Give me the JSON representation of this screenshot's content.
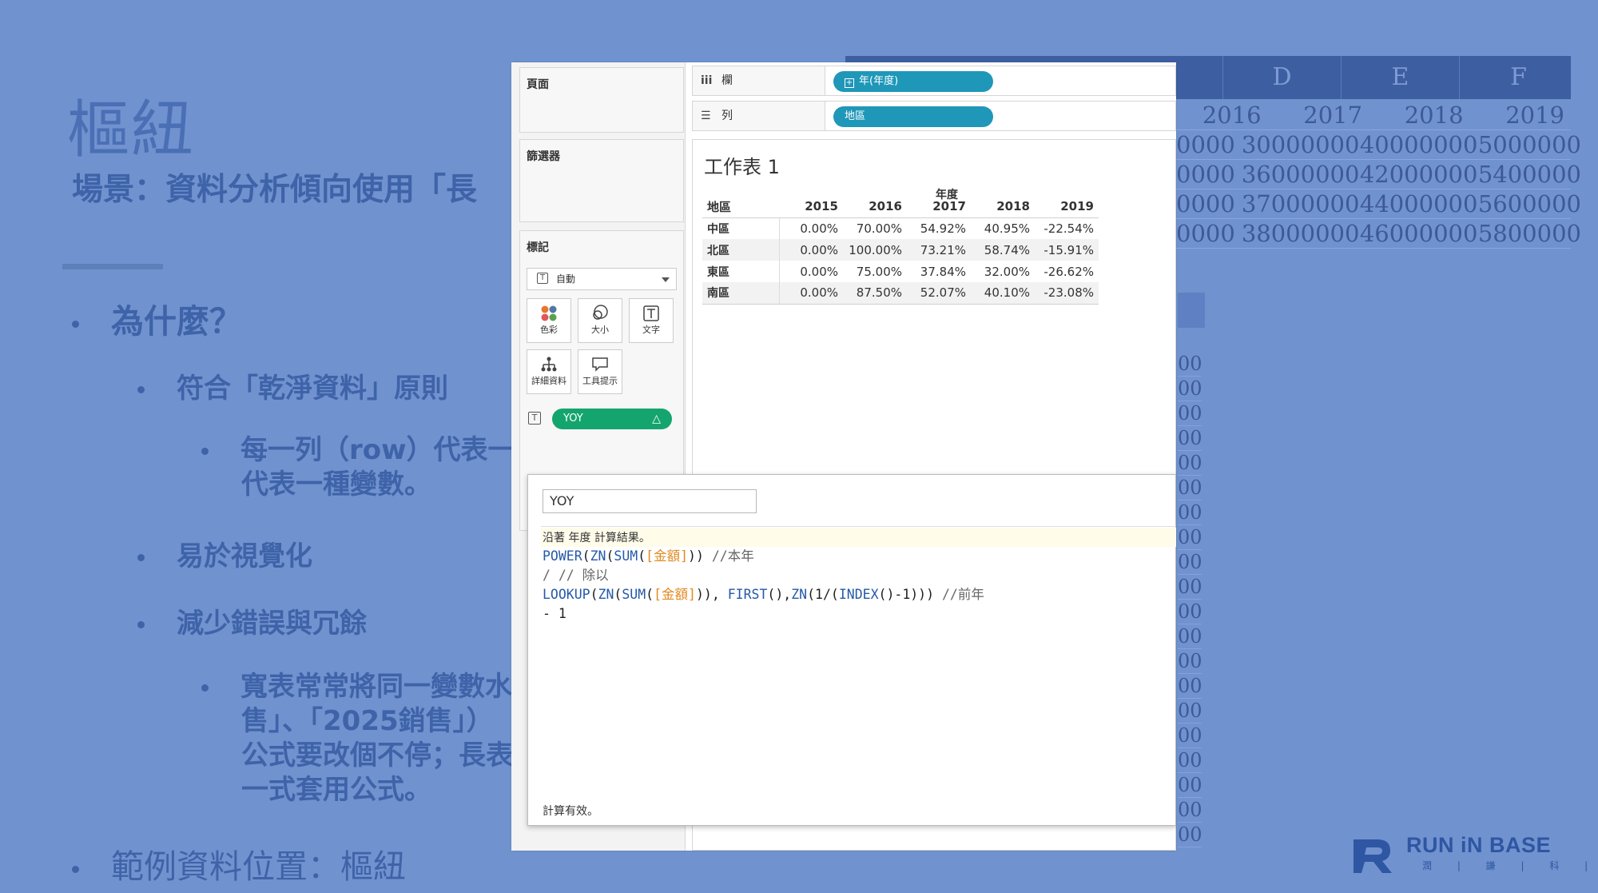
{
  "slide": {
    "title": "樞紐",
    "subtitle": "場景：資料分析傾向使用「長",
    "bullets": {
      "b1": "為什麼？",
      "b2": "符合「乾淨資料」原則",
      "b3_line1": "每一列（row）代表一",
      "b3_line2": "代表一種變數。",
      "b4": "易於視覺化",
      "b5": "減少錯誤與冗餘",
      "b6_line1": "寬表常常將同一變數水",
      "b6_line2": "售」、「2025銷售」）",
      "b6_line3": "公式要改個不停；長表",
      "b6_line4": "一式套用公式。",
      "b7": "範例資料位置：樞紐"
    }
  },
  "background_sheet": {
    "columns": [
      "D",
      "E",
      "F"
    ],
    "rows": [
      [
        "2016",
        "2017",
        "2018",
        "2019"
      ],
      [
        "0000",
        "30000000",
        "40000000",
        "5000000"
      ],
      [
        "0000",
        "36000000",
        "42000000",
        "5400000"
      ],
      [
        "0000",
        "37000000",
        "44000000",
        "5600000"
      ],
      [
        "0000",
        "38000000",
        "46000000",
        "5800000"
      ]
    ],
    "side_values": [
      "00",
      "00",
      "00",
      "00",
      "00",
      "00",
      "00",
      "00",
      "00",
      "00",
      "00",
      "00",
      "00",
      "00",
      "00",
      "00",
      "00",
      "00",
      "00",
      "00"
    ]
  },
  "logo": {
    "text": "RUN iN BASE",
    "sub": "潤 | 謙 | 科 | 技"
  },
  "tableau": {
    "cards": {
      "pages": "頁面",
      "filters": "篩選器",
      "marks": "標記"
    },
    "marks": {
      "type_select": "自動",
      "buttons": {
        "color": "色彩",
        "size": "大小",
        "text": "文字",
        "detail": "詳細資料",
        "tooltip": "工具提示"
      },
      "yoy_pill": "YOY",
      "yoy_pill_delta": "△"
    },
    "shelves": {
      "columns_label": "欄",
      "columns_pill": "年(年度)",
      "columns_pill_icon": "⊞",
      "rows_label": "列",
      "rows_pill": "地區"
    },
    "sheet": {
      "title": "工作表 1",
      "year_caption": "年度",
      "row_header": "地區",
      "years": [
        "2015",
        "2016",
        "2017",
        "2018",
        "2019"
      ],
      "rows": [
        {
          "region": "中區",
          "values": [
            "0.00%",
            "70.00%",
            "54.92%",
            "40.95%",
            "-22.54%"
          ]
        },
        {
          "region": "北區",
          "values": [
            "0.00%",
            "100.00%",
            "73.21%",
            "58.74%",
            "-15.91%"
          ]
        },
        {
          "region": "東區",
          "values": [
            "0.00%",
            "75.00%",
            "37.84%",
            "32.00%",
            "-26.62%"
          ]
        },
        {
          "region": "南區",
          "values": [
            "0.00%",
            "87.50%",
            "52.07%",
            "40.10%",
            "-23.08%"
          ]
        }
      ]
    },
    "calc": {
      "name": "YOY",
      "hint": "沿著 年度 計算結果。",
      "status": "計算有效。",
      "code": {
        "l1_fn1": "POWER",
        "l1_fn2": "ZN",
        "l1_fn3": "SUM",
        "l1_field": "[金額]",
        "l1_comment": "//本年",
        "l2": "/ // 除以",
        "l3_fn1": "LOOKUP",
        "l3_fn2": "ZN",
        "l3_fn3": "SUM",
        "l3_field": "[金額]",
        "l3_fn4": "FIRST",
        "l3_fn5": "ZN",
        "l3_fn6": "INDEX",
        "l3_comment": "//前年",
        "l4": "- 1"
      }
    }
  }
}
